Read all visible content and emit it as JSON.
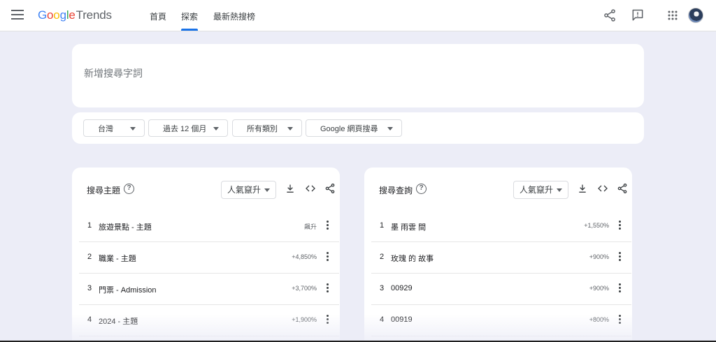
{
  "header": {
    "logo_google": [
      "G",
      "o",
      "o",
      "g",
      "l",
      "e"
    ],
    "logo_trends": "Trends",
    "tabs": [
      {
        "label": "首頁"
      },
      {
        "label": "探索"
      },
      {
        "label": "最新熱搜榜"
      }
    ],
    "active_tab": "探索",
    "icons": [
      "menu-icon",
      "share-icon",
      "feedback-icon",
      "apps-icon",
      "avatar"
    ]
  },
  "search": {
    "placeholder": "新增搜尋字詞"
  },
  "filters": [
    {
      "label": "台灣"
    },
    {
      "label": "過去 12 個月"
    },
    {
      "label": "所有類別"
    },
    {
      "label": "Google 網頁搜尋"
    }
  ],
  "panels": {
    "topics": {
      "title": "搜尋主題",
      "sort": "人氣竄升",
      "rows": [
        {
          "num": "1",
          "label": "旅遊景點 - 主題",
          "value": "飆升"
        },
        {
          "num": "2",
          "label": "職業 - 主題",
          "value": "+4,850%"
        },
        {
          "num": "3",
          "label": "門票 - Admission",
          "value": "+3,700%"
        },
        {
          "num": "4",
          "label": "2024 - 主題",
          "value": "+1,900%"
        }
      ]
    },
    "queries": {
      "title": "搜尋查詢",
      "sort": "人氣竄升",
      "rows": [
        {
          "num": "1",
          "label": "墨 雨雲 間",
          "value": "+1,550%"
        },
        {
          "num": "2",
          "label": "玫瑰 的 故事",
          "value": "+900%"
        },
        {
          "num": "3",
          "label": "00929",
          "value": "+900%"
        },
        {
          "num": "4",
          "label": "00919",
          "value": "+800%"
        }
      ]
    }
  },
  "colors": {
    "accent": "#1a73e8",
    "page_bg": "#ecedf7"
  }
}
